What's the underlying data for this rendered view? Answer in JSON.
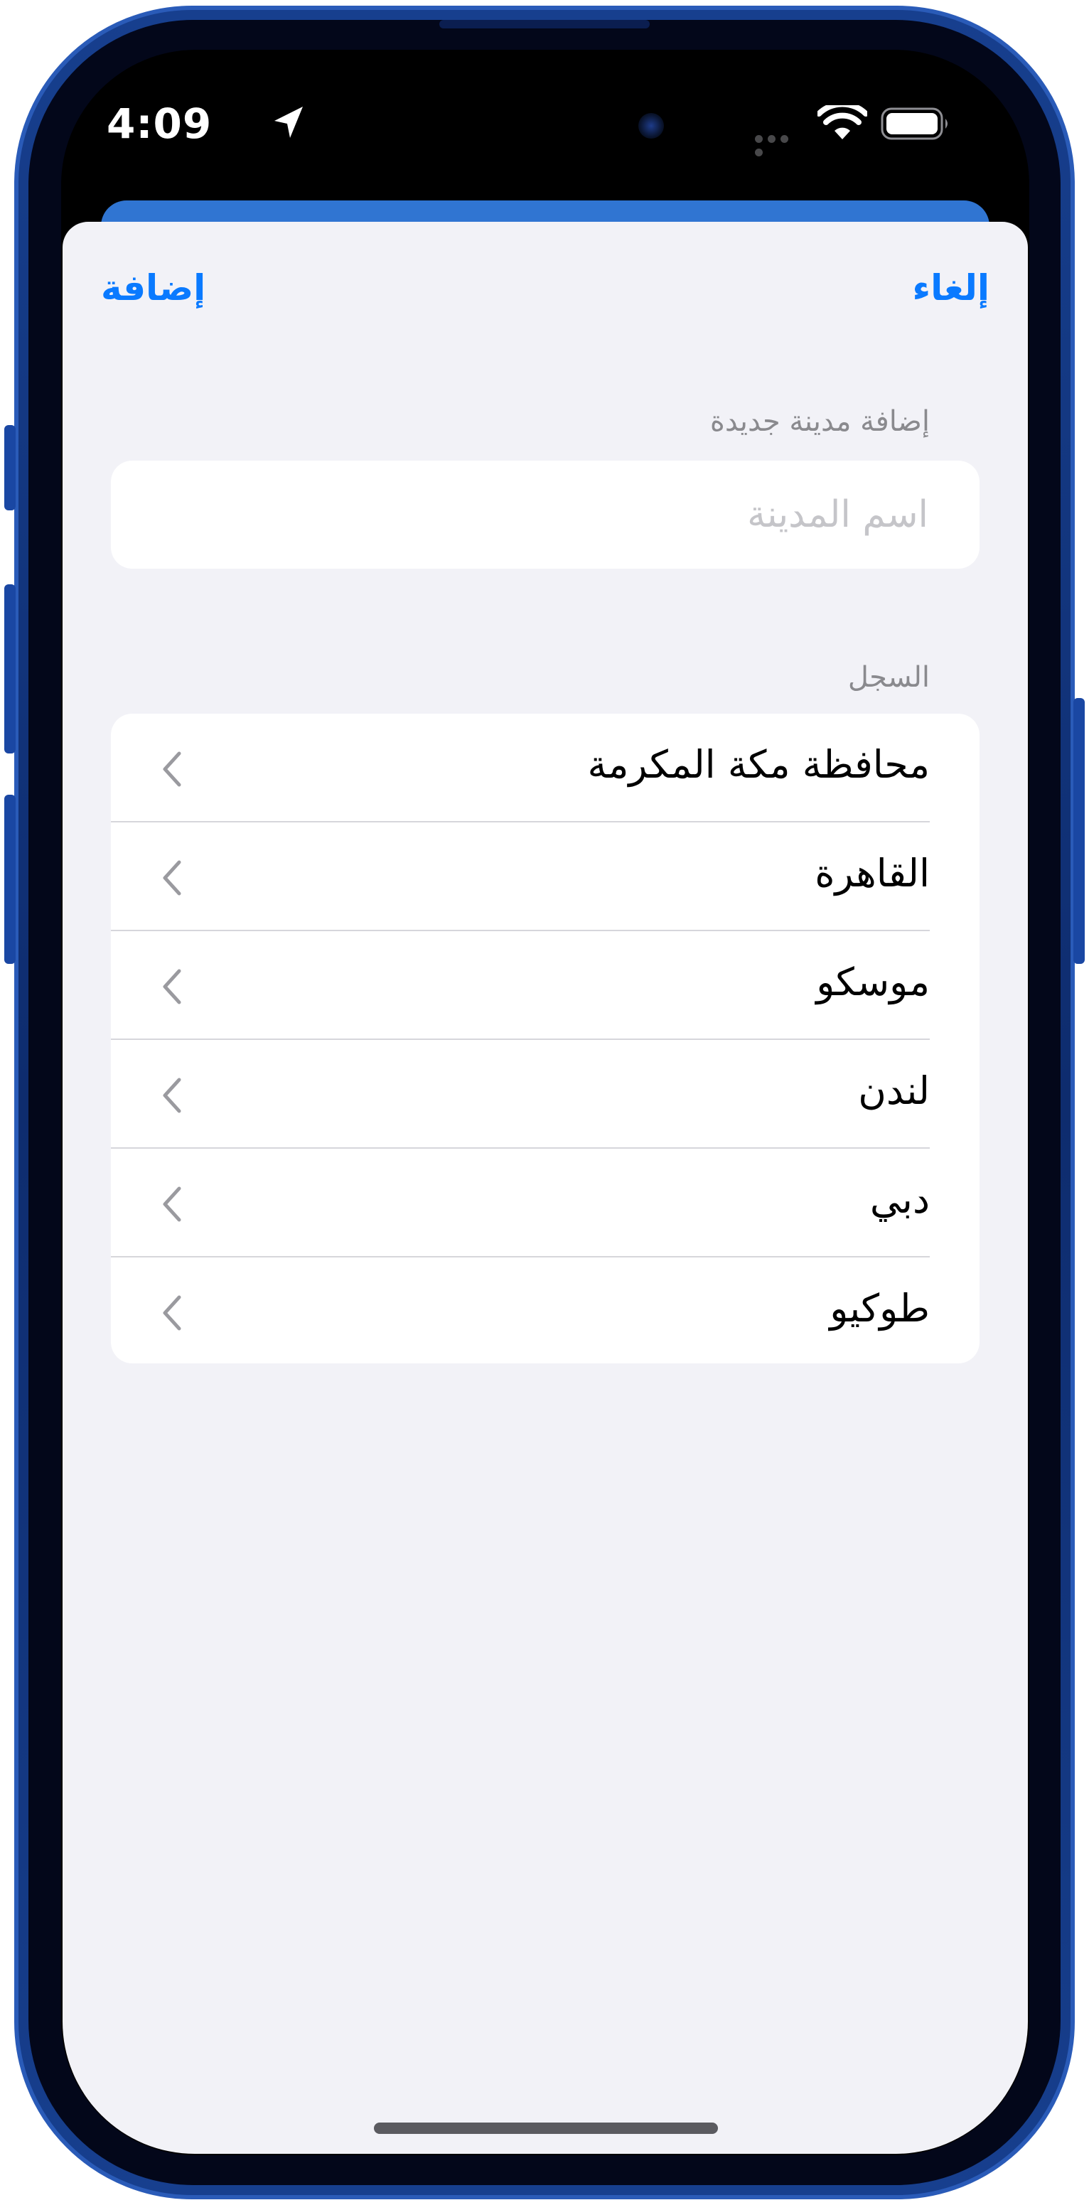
{
  "status_bar": {
    "time": "4:09",
    "icons": [
      "location-arrow-icon",
      "signal-dots-icon",
      "wifi-icon",
      "battery-icon"
    ]
  },
  "nav": {
    "add_label": "إضافة",
    "cancel_label": "إلغاء"
  },
  "new_city": {
    "header": "إضافة مدينة جديدة",
    "placeholder": "اسم المدينة",
    "value": ""
  },
  "history": {
    "header": "السجل",
    "items": [
      {
        "label": "محافظة مكة المكرمة"
      },
      {
        "label": "القاهرة"
      },
      {
        "label": "موسكو"
      },
      {
        "label": "لندن"
      },
      {
        "label": "دبي"
      },
      {
        "label": "طوكيو"
      }
    ]
  },
  "colors": {
    "accent": "#0a7aff",
    "sheet_background": "#f2f2f7",
    "card_background": "#ffffff",
    "secondary_text": "#8a8a8e",
    "placeholder_text": "#c5c5c9",
    "separator": "#d6d6db",
    "underlying_header": "#3075d2",
    "device_frame": "#173f8e"
  }
}
